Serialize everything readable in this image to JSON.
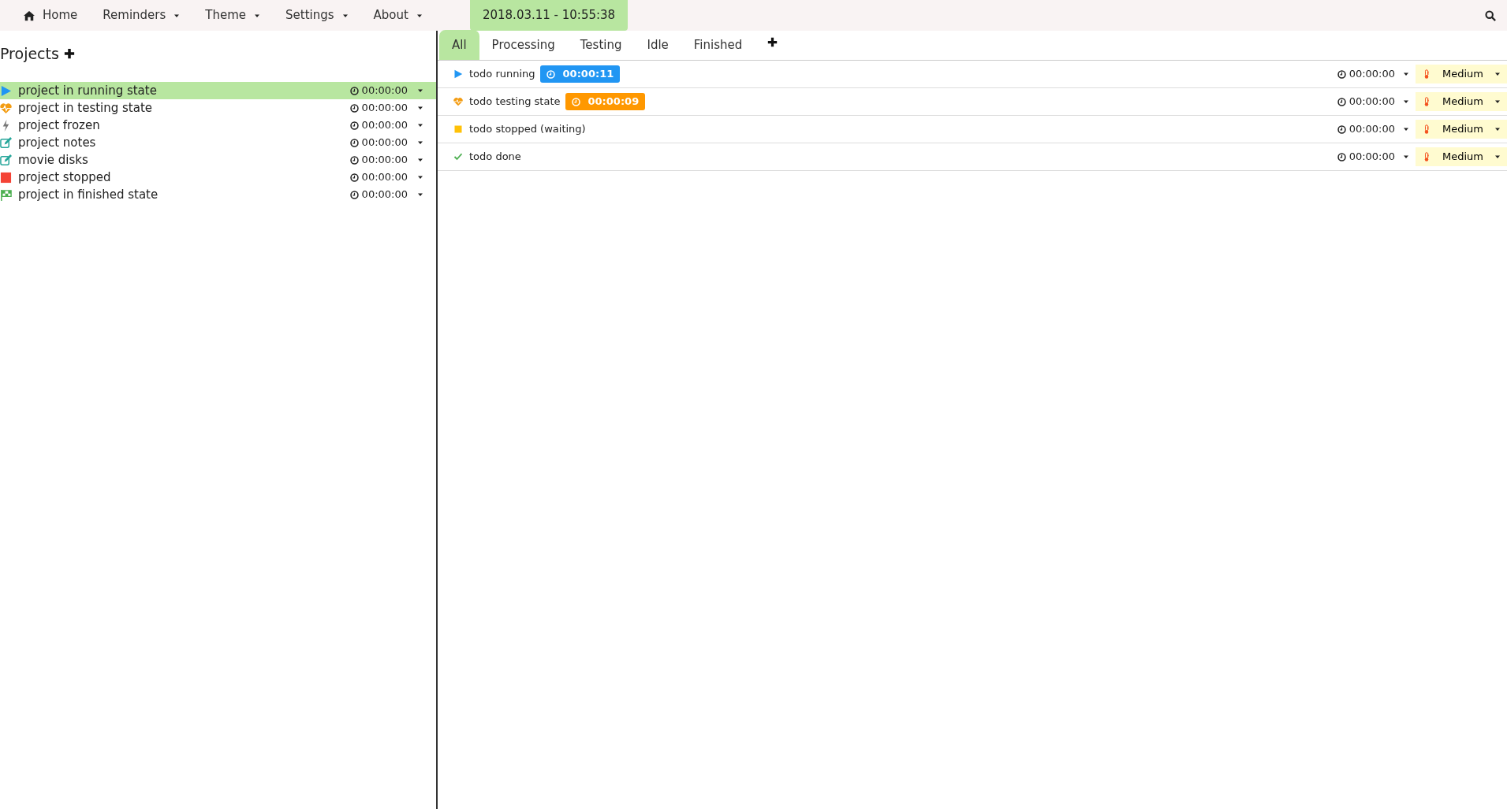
{
  "navbar": {
    "items": [
      {
        "label": "Home",
        "kind": "home"
      },
      {
        "label": "Reminders",
        "kind": "dropdown"
      },
      {
        "label": "Theme",
        "kind": "dropdown"
      },
      {
        "label": "Settings",
        "kind": "dropdown"
      },
      {
        "label": "About",
        "kind": "dropdown"
      }
    ],
    "clock": "2018.03.11 - 10:55:38"
  },
  "projects": {
    "title": "Projects",
    "items": [
      {
        "name": "project in running state",
        "kind": "running",
        "time": "00:00:00",
        "selected": true
      },
      {
        "name": "project in testing state",
        "kind": "testing",
        "time": "00:00:00",
        "selected": false
      },
      {
        "name": "project frozen",
        "kind": "frozen",
        "time": "00:00:00",
        "selected": false
      },
      {
        "name": "project notes",
        "kind": "notes",
        "time": "00:00:00",
        "selected": false
      },
      {
        "name": "movie disks",
        "kind": "notes",
        "time": "00:00:00",
        "selected": false
      },
      {
        "name": "project stopped",
        "kind": "stopped",
        "time": "00:00:00",
        "selected": false
      },
      {
        "name": "project in finished state",
        "kind": "finished",
        "time": "00:00:00",
        "selected": false
      }
    ]
  },
  "tabs": [
    {
      "label": "All",
      "selected": true
    },
    {
      "label": "Processing",
      "selected": false
    },
    {
      "label": "Testing",
      "selected": false
    },
    {
      "label": "Idle",
      "selected": false
    },
    {
      "label": "Finished",
      "selected": false
    }
  ],
  "todos": [
    {
      "name": "todo running",
      "kind": "running",
      "timer": {
        "text": "00:00:11",
        "color": "#2196f3"
      },
      "time": "00:00:00",
      "priority": "Medium"
    },
    {
      "name": "todo testing state",
      "kind": "testing",
      "timer": {
        "text": "00:00:09",
        "color": "#ff9800"
      },
      "time": "00:00:00",
      "priority": "Medium"
    },
    {
      "name": "todo stopped (waiting)",
      "kind": "waiting",
      "time": "00:00:00",
      "priority": "Medium"
    },
    {
      "name": "todo done",
      "kind": "done",
      "time": "00:00:00",
      "priority": "Medium"
    }
  ]
}
